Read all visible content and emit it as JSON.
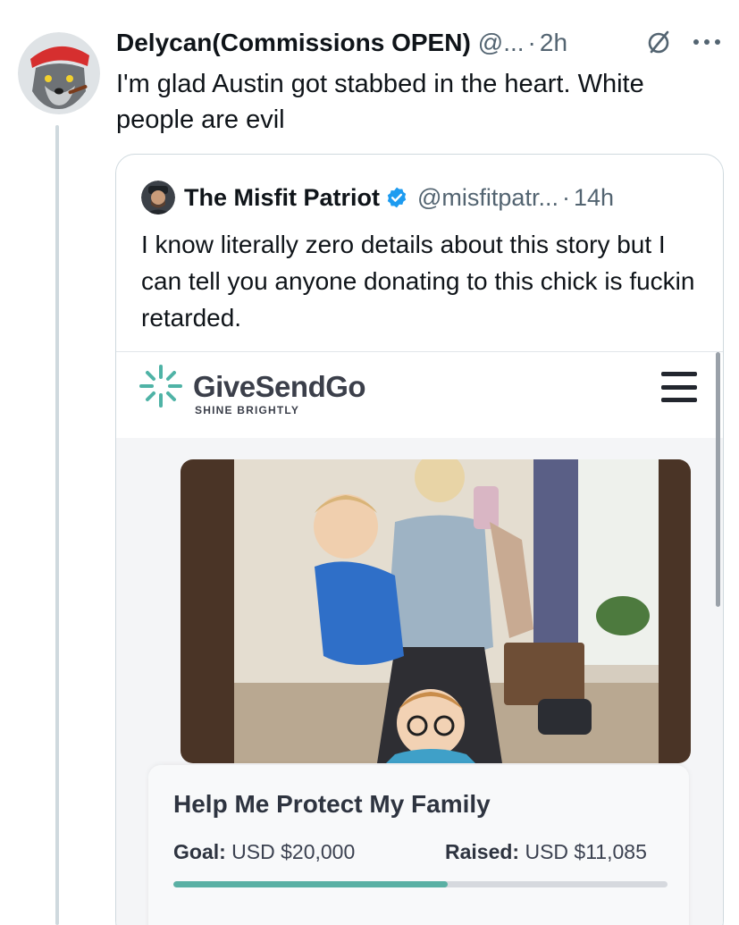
{
  "tweet": {
    "display_name": "Delycan(Commissions OPEN)",
    "handle": "@...",
    "separator": "·",
    "time": "2h",
    "text": "I'm glad Austin got stabbed in the heart. White people are evil",
    "avatar_icon": "wolf-pirate-avatar",
    "more_icon": "more-dots-icon",
    "grok_icon": "slashed-circle-icon"
  },
  "quote": {
    "display_name": "The Misfit Patriot",
    "verified_icon": "verified-badge-icon",
    "handle": "@misfitpatr...",
    "separator": "·",
    "time": "14h",
    "text": "I know literally zero details about this story but I can tell you anyone donating to this chick is fuckin retarded."
  },
  "givesendgo": {
    "brand": "GiveSendGo",
    "tagline": "SHINE BRIGHTLY",
    "menu_icon": "hamburger-menu-icon",
    "campaign_title": "Help Me Protect My Family",
    "goal_label": "Goal:",
    "goal_value": "USD $20,000",
    "raised_label": "Raised:",
    "raised_value": "USD $11,085",
    "progress_fraction": 0.5543
  },
  "colors": {
    "text": "#0f1419",
    "muted": "#536471",
    "verified": "#1d9bf0",
    "brand_green": "#5ab0a4"
  }
}
